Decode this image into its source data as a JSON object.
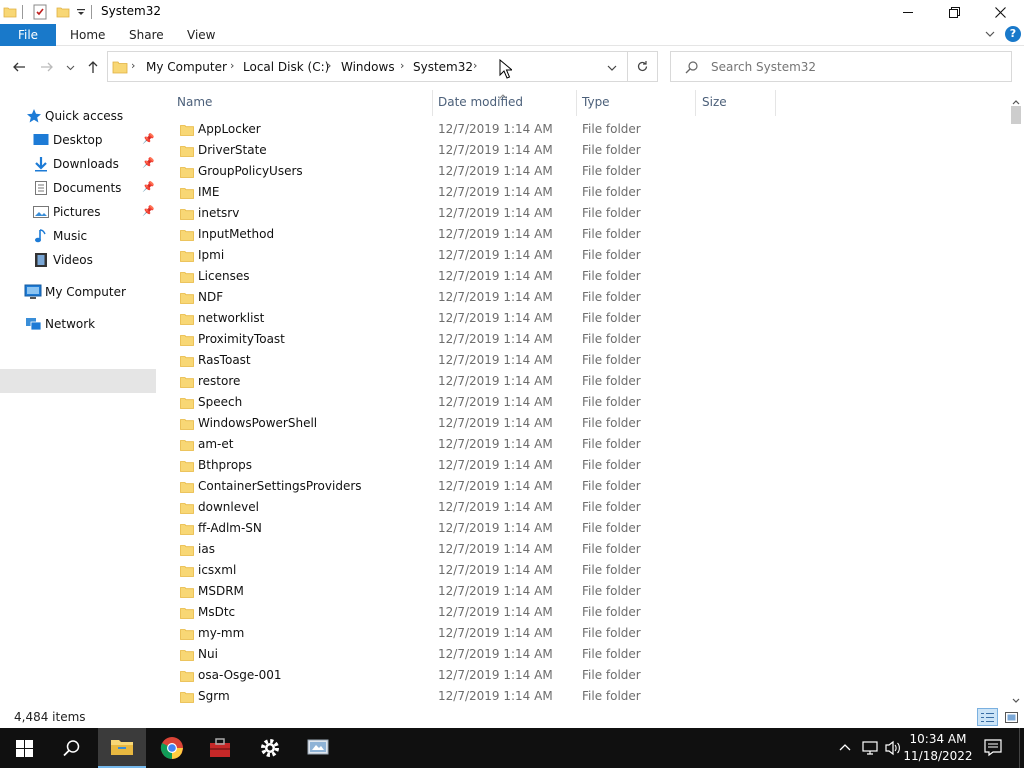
{
  "window": {
    "title": "System32"
  },
  "ribbon": {
    "tabs": [
      "File",
      "Home",
      "Share",
      "View"
    ]
  },
  "address": {
    "crumbs": [
      "My Computer",
      "Local Disk (C:)",
      "Windows",
      "System32"
    ]
  },
  "search": {
    "placeholder": "Search System32"
  },
  "sidebar": {
    "quick_access": "Quick access",
    "items": [
      {
        "label": "Desktop",
        "icon": "desktop-icon",
        "pinned": true
      },
      {
        "label": "Downloads",
        "icon": "downloads-icon",
        "pinned": true
      },
      {
        "label": "Documents",
        "icon": "documents-icon",
        "pinned": true
      },
      {
        "label": "Pictures",
        "icon": "pictures-icon",
        "pinned": true
      },
      {
        "label": "Music",
        "icon": "music-icon",
        "pinned": false
      },
      {
        "label": "Videos",
        "icon": "videos-icon",
        "pinned": false
      }
    ],
    "my_computer": "My Computer",
    "network": "Network"
  },
  "columns": {
    "name": "Name",
    "date": "Date modified",
    "type": "Type",
    "size": "Size"
  },
  "files": [
    {
      "name": "AppLocker",
      "date": "12/7/2019 1:14 AM",
      "type": "File folder"
    },
    {
      "name": "DriverState",
      "date": "12/7/2019 1:14 AM",
      "type": "File folder"
    },
    {
      "name": "GroupPolicyUsers",
      "date": "12/7/2019 1:14 AM",
      "type": "File folder"
    },
    {
      "name": "IME",
      "date": "12/7/2019 1:14 AM",
      "type": "File folder"
    },
    {
      "name": "inetsrv",
      "date": "12/7/2019 1:14 AM",
      "type": "File folder"
    },
    {
      "name": "InputMethod",
      "date": "12/7/2019 1:14 AM",
      "type": "File folder"
    },
    {
      "name": "Ipmi",
      "date": "12/7/2019 1:14 AM",
      "type": "File folder"
    },
    {
      "name": "Licenses",
      "date": "12/7/2019 1:14 AM",
      "type": "File folder"
    },
    {
      "name": "NDF",
      "date": "12/7/2019 1:14 AM",
      "type": "File folder"
    },
    {
      "name": "networklist",
      "date": "12/7/2019 1:14 AM",
      "type": "File folder"
    },
    {
      "name": "ProximityToast",
      "date": "12/7/2019 1:14 AM",
      "type": "File folder"
    },
    {
      "name": "RasToast",
      "date": "12/7/2019 1:14 AM",
      "type": "File folder"
    },
    {
      "name": "restore",
      "date": "12/7/2019 1:14 AM",
      "type": "File folder"
    },
    {
      "name": "Speech",
      "date": "12/7/2019 1:14 AM",
      "type": "File folder"
    },
    {
      "name": "WindowsPowerShell",
      "date": "12/7/2019 1:14 AM",
      "type": "File folder"
    },
    {
      "name": "am-et",
      "date": "12/7/2019 1:14 AM",
      "type": "File folder"
    },
    {
      "name": "Bthprops",
      "date": "12/7/2019 1:14 AM",
      "type": "File folder"
    },
    {
      "name": "ContainerSettingsProviders",
      "date": "12/7/2019 1:14 AM",
      "type": "File folder"
    },
    {
      "name": "downlevel",
      "date": "12/7/2019 1:14 AM",
      "type": "File folder"
    },
    {
      "name": "ff-Adlm-SN",
      "date": "12/7/2019 1:14 AM",
      "type": "File folder"
    },
    {
      "name": "ias",
      "date": "12/7/2019 1:14 AM",
      "type": "File folder"
    },
    {
      "name": "icsxml",
      "date": "12/7/2019 1:14 AM",
      "type": "File folder"
    },
    {
      "name": "MSDRM",
      "date": "12/7/2019 1:14 AM",
      "type": "File folder"
    },
    {
      "name": "MsDtc",
      "date": "12/7/2019 1:14 AM",
      "type": "File folder"
    },
    {
      "name": "my-mm",
      "date": "12/7/2019 1:14 AM",
      "type": "File folder"
    },
    {
      "name": "Nui",
      "date": "12/7/2019 1:14 AM",
      "type": "File folder"
    },
    {
      "name": "osa-Osge-001",
      "date": "12/7/2019 1:14 AM",
      "type": "File folder"
    },
    {
      "name": "Sgrm",
      "date": "12/7/2019 1:14 AM",
      "type": "File folder"
    }
  ],
  "status": {
    "item_count": "4,484 items"
  },
  "taskbar": {
    "time": "10:34 AM",
    "date": "11/18/2022"
  },
  "colors": {
    "file_tab": "#1979ca",
    "folder": "#f8d775",
    "folder_dark": "#e8b840",
    "selection": "#e5e5e5",
    "taskbar": "#101010"
  }
}
